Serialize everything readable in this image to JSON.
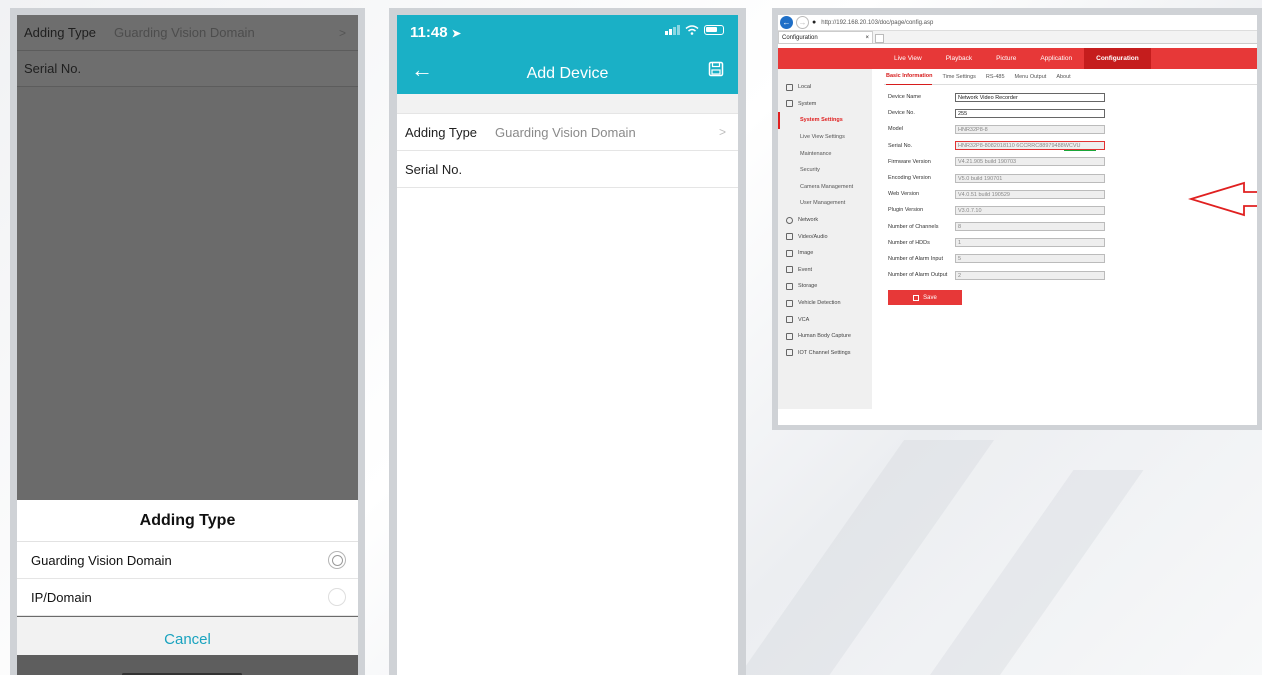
{
  "panel1": {
    "row_adding_type": {
      "label": "Adding Type",
      "value": "Guarding Vision Domain"
    },
    "row_serial": {
      "label": "Serial No."
    },
    "sheet": {
      "title": "Adding Type",
      "options": [
        "Guarding Vision Domain",
        "IP/Domain"
      ],
      "selected_index": 0,
      "cancel": "Cancel"
    }
  },
  "panel2": {
    "status_time": "11:48",
    "title": "Add Device",
    "row_adding_type": {
      "label": "Adding Type",
      "value": "Guarding Vision Domain"
    },
    "row_serial": {
      "label": "Serial No."
    },
    "header_color": "#1ab0c6"
  },
  "panel3": {
    "url": "http://192.168.20.103/doc/page/config.asp",
    "tab_title": "Configuration",
    "menu": [
      "Live View",
      "Playback",
      "Picture",
      "Application",
      "Configuration"
    ],
    "menu_active_index": 4,
    "sidebar": [
      {
        "label": "Local",
        "level": 0
      },
      {
        "label": "System",
        "level": 0
      },
      {
        "label": "System Settings",
        "level": 1,
        "active": true
      },
      {
        "label": "Live View Settings",
        "level": 1
      },
      {
        "label": "Maintenance",
        "level": 1
      },
      {
        "label": "Security",
        "level": 1
      },
      {
        "label": "Camera Management",
        "level": 1
      },
      {
        "label": "User Management",
        "level": 1
      },
      {
        "label": "Network",
        "level": 0
      },
      {
        "label": "Video/Audio",
        "level": 0
      },
      {
        "label": "Image",
        "level": 0
      },
      {
        "label": "Event",
        "level": 0
      },
      {
        "label": "Storage",
        "level": 0
      },
      {
        "label": "Vehicle Detection",
        "level": 0
      },
      {
        "label": "VCA",
        "level": 0
      },
      {
        "label": "Human Body Capture",
        "level": 0
      },
      {
        "label": "IOT Channel Settings",
        "level": 0
      }
    ],
    "subtabs": [
      "Basic Information",
      "Time Settings",
      "RS-485",
      "Menu Output",
      "About"
    ],
    "fields": [
      {
        "label": "Device Name",
        "value": "Network Video Recorder",
        "editable": true
      },
      {
        "label": "Device No.",
        "value": "255",
        "editable": true
      },
      {
        "label": "Model",
        "value": "HNR32P8-8"
      },
      {
        "label": "Serial No.",
        "value": "HNR32P8-8082018110 6CCRRC88979488WCVU",
        "highlight": true
      },
      {
        "label": "Firmware Version",
        "value": "V4.21.905 build 190703"
      },
      {
        "label": "Encoding Version",
        "value": "V5.0 build 190701"
      },
      {
        "label": "Web Version",
        "value": "V4.0.51 build 190529"
      },
      {
        "label": "Plugin Version",
        "value": "V3.0.7.10"
      },
      {
        "label": "Number of Channels",
        "value": "8"
      },
      {
        "label": "Number of HDDs",
        "value": "1"
      },
      {
        "label": "Number of Alarm Input",
        "value": "5"
      },
      {
        "label": "Number of Alarm Output",
        "value": "2"
      }
    ],
    "save_label": "Save",
    "accent_color": "#e73838"
  }
}
